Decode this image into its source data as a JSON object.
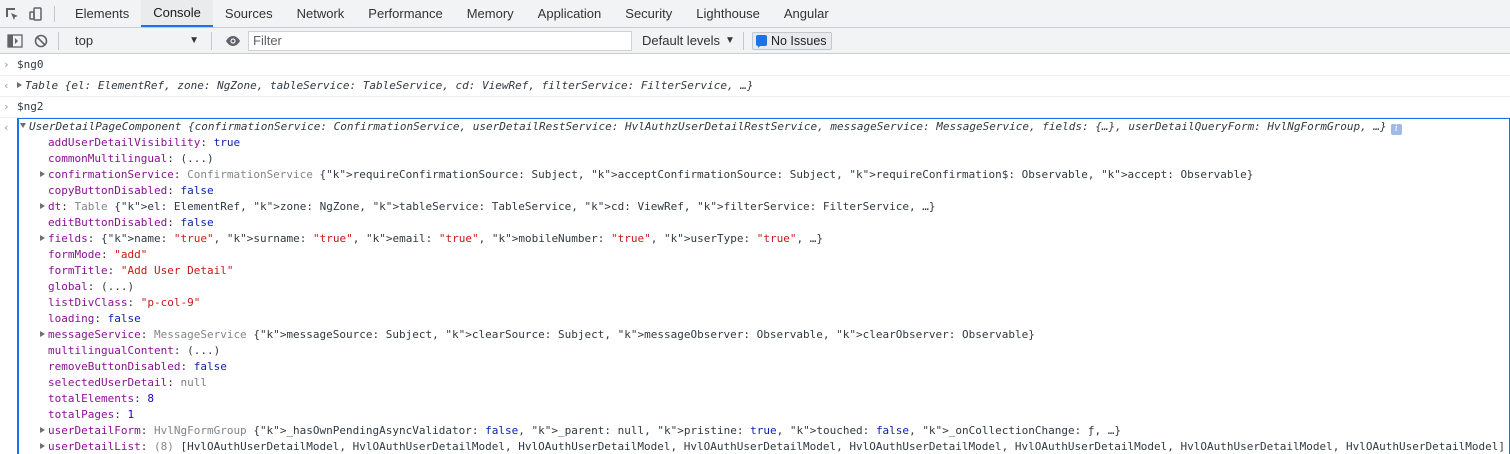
{
  "tabs": [
    {
      "label": "Elements"
    },
    {
      "label": "Console",
      "active": true
    },
    {
      "label": "Sources"
    },
    {
      "label": "Network"
    },
    {
      "label": "Performance"
    },
    {
      "label": "Memory"
    },
    {
      "label": "Application"
    },
    {
      "label": "Security"
    },
    {
      "label": "Lighthouse"
    },
    {
      "label": "Angular"
    }
  ],
  "toolbar": {
    "context": "top",
    "filter_placeholder": "Filter",
    "levels": "Default levels",
    "issues": "No Issues"
  },
  "console": {
    "cmd1": "$ng0",
    "res1": {
      "name": "Table",
      "summary": "{el: ElementRef, zone: NgZone, tableService: TableService, cd: ViewRef, filterService: FilterService, …}"
    },
    "cmd2": "$ng2",
    "res2": {
      "name": "UserDetailPageComponent",
      "summary": "{confirmationService: ConfirmationService, userDetailRestService: HvlAuthzUserDetailRestService, messageService: MessageService, fields: {…}, userDetailQueryForm: HvlNgFormGroup, …}",
      "props": [
        {
          "key": "addUserDetailVisibility",
          "value": "true",
          "kind": "kw"
        },
        {
          "key": "commonMultilingual",
          "value": "(...)",
          "kind": "plain"
        },
        {
          "key": "confirmationService",
          "value": "ConfirmationService {requireConfirmationSource: Subject, acceptConfirmationSource: Subject, requireConfirmation$: Observable, accept: Observable}",
          "kind": "obj",
          "expand": true
        },
        {
          "key": "copyButtonDisabled",
          "value": "false",
          "kind": "kw"
        },
        {
          "key": "dt",
          "value": "Table {el: ElementRef, zone: NgZone, tableService: TableService, cd: ViewRef, filterService: FilterService, …}",
          "kind": "obj",
          "expand": true
        },
        {
          "key": "editButtonDisabled",
          "value": "false",
          "kind": "kw"
        },
        {
          "key": "fields",
          "value": "{name: \"true\", surname: \"true\", email: \"true\", mobileNumber: \"true\", userType: \"true\", …}",
          "kind": "plain",
          "expand": true
        },
        {
          "key": "formMode",
          "value": "\"add\"",
          "kind": "str"
        },
        {
          "key": "formTitle",
          "value": "\"Add User Detail\"",
          "kind": "str"
        },
        {
          "key": "global",
          "value": "(...)",
          "kind": "plain"
        },
        {
          "key": "listDivClass",
          "value": "\"p-col-9\"",
          "kind": "str"
        },
        {
          "key": "loading",
          "value": "false",
          "kind": "kw"
        },
        {
          "key": "messageService",
          "value": "MessageService {messageSource: Subject, clearSource: Subject, messageObserver: Observable, clearObserver: Observable}",
          "kind": "obj",
          "expand": true
        },
        {
          "key": "multilingualContent",
          "value": "(...)",
          "kind": "plain"
        },
        {
          "key": "removeButtonDisabled",
          "value": "false",
          "kind": "kw"
        },
        {
          "key": "selectedUserDetail",
          "value": "null",
          "kind": "null"
        },
        {
          "key": "totalElements",
          "value": "8",
          "kind": "num"
        },
        {
          "key": "totalPages",
          "value": "1",
          "kind": "num"
        },
        {
          "key": "userDetailForm",
          "value": "HvlNgFormGroup {_hasOwnPendingAsyncValidator: false, _parent: null, pristine: true, touched: false, _onCollectionChange: ƒ, …}",
          "kind": "obj",
          "expand": true
        },
        {
          "key": "userDetailList",
          "value": "(8) [HvlOAuthUserDetailModel, HvlOAuthUserDetailModel, HvlOAuthUserDetailModel, HvlOAuthUserDetailModel, HvlOAuthUserDetailModel, HvlOAuthUserDetailModel, HvlOAuthUserDetailModel, HvlOAuthUserDetailModel]",
          "kind": "arr",
          "expand": true
        }
      ]
    }
  }
}
